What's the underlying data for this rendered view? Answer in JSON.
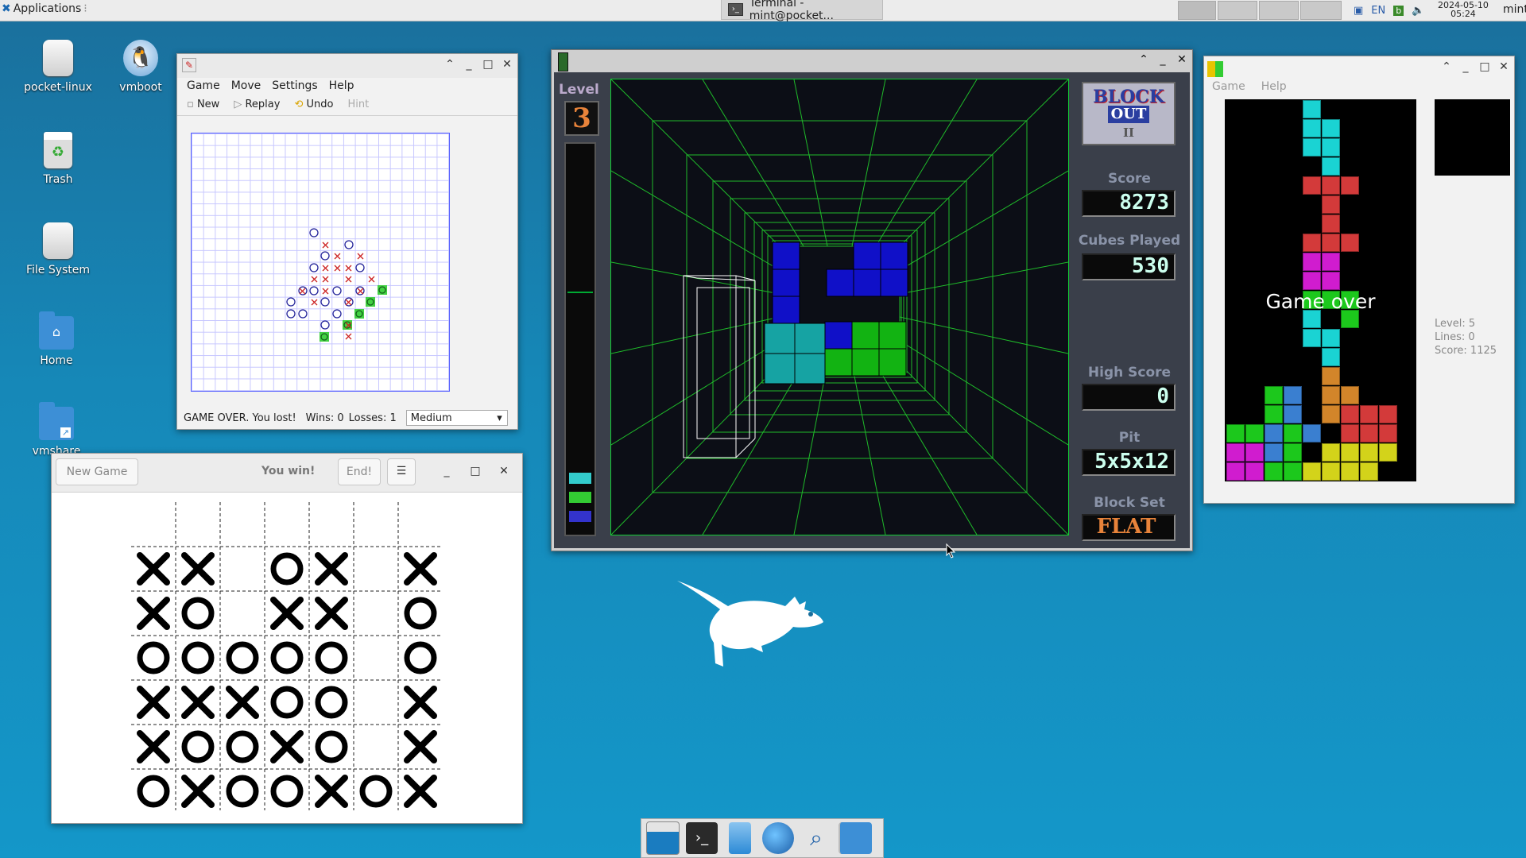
{
  "panel": {
    "applications_label": "Applications",
    "task_label": "Terminal - mint@pocket...",
    "lang": "EN",
    "date": "2024-05-10",
    "time": "05:24",
    "user": "mint"
  },
  "desktop": {
    "icons": [
      {
        "label": "pocket-linux"
      },
      {
        "label": "vmboot"
      },
      {
        "label": "Trash"
      },
      {
        "label": "File System"
      },
      {
        "label": "Home"
      },
      {
        "label": "vmshare"
      }
    ]
  },
  "gomoku": {
    "menu": [
      "Game",
      "Move",
      "Settings",
      "Help"
    ],
    "toolbar": {
      "new": "New",
      "replay": "Replay",
      "undo": "Undo",
      "hint": "Hint"
    },
    "status": "GAME OVER. You lost!",
    "wins": "Wins: 0",
    "losses": "Losses: 1",
    "difficulty": "Medium"
  },
  "tictactoe": {
    "new_game": "New Game",
    "status": "You win!",
    "end": "End!",
    "grid": [
      [
        "",
        "",
        "",
        "",
        "",
        "",
        ""
      ],
      [
        "X",
        "X",
        "",
        "O",
        "X",
        "",
        "X"
      ],
      [
        "X",
        "O",
        "",
        "X",
        "X",
        "",
        "O"
      ],
      [
        "O",
        "O",
        "O",
        "O",
        "O",
        "",
        "O"
      ],
      [
        "X",
        "X",
        "X",
        "O",
        "O",
        "",
        "X"
      ],
      [
        "X",
        "O",
        "O",
        "X",
        "O",
        "",
        "X"
      ],
      [
        "O",
        "X",
        "O",
        "O",
        "X",
        "O",
        "X"
      ]
    ]
  },
  "blockout": {
    "level_label": "Level",
    "level": "3",
    "logo_line1": "BLOCK",
    "logo_line2": "OUT",
    "logo_line3": "II",
    "score_label": "Score",
    "score": "8273",
    "cubes_label": "Cubes Played",
    "cubes": "530",
    "high_label": "High Score",
    "high": "0",
    "pit_label": "Pit",
    "pit": "5x5x12",
    "set_label": "Block Set",
    "set": "FLAT"
  },
  "tetris": {
    "menu": [
      "Game",
      "Help"
    ],
    "gameover": "Game over",
    "level": "Level: 5",
    "lines": "Lines: 0",
    "score": "Score: 1125"
  }
}
